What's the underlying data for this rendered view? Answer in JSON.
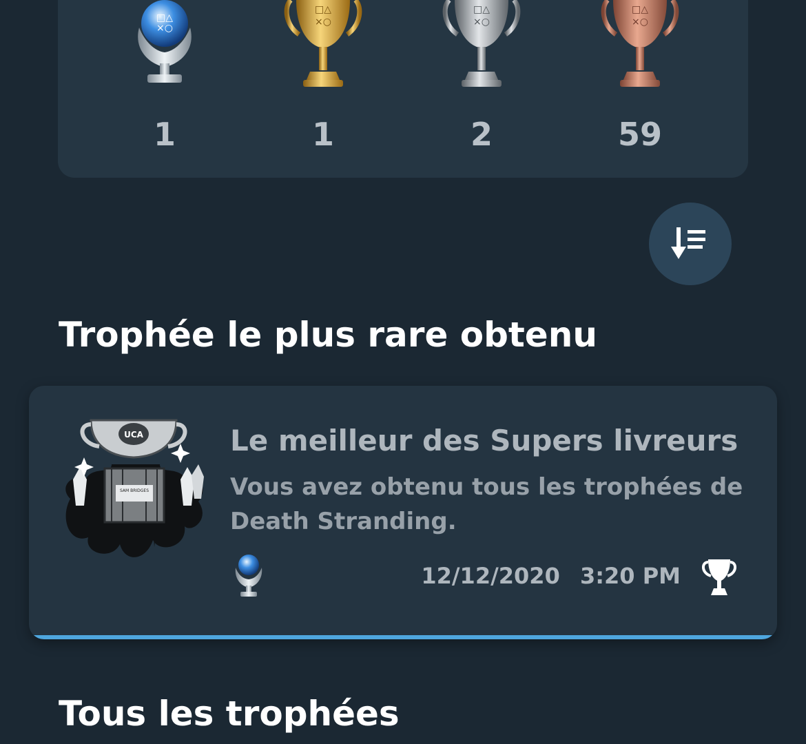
{
  "summary": {
    "trophies": [
      {
        "grade": "platinum",
        "icon": "platinum-trophy-icon",
        "count": "1"
      },
      {
        "grade": "gold",
        "icon": "gold-trophy-icon",
        "count": "1"
      },
      {
        "grade": "silver",
        "icon": "silver-trophy-icon",
        "count": "2"
      },
      {
        "grade": "bronze",
        "icon": "bronze-trophy-icon",
        "count": "59"
      }
    ]
  },
  "sort_button": {
    "icon": "sort-descending-icon"
  },
  "rarest": {
    "heading": "Trophée le plus rare obtenu",
    "name": "Le meilleur des Supers livreurs",
    "description": "Vous avez obtenu tous les trophées de Death Stranding.",
    "art_icon": "uca-trophy-art",
    "grade_icon": "platinum-trophy-icon",
    "date": "12/12/2020",
    "time": "3:20 PM",
    "earned_icon": "trophy-earned-icon",
    "accent_color": "#4ea6de"
  },
  "all_trophies": {
    "heading": "Tous les trophées"
  },
  "colors": {
    "background": "#1b2833",
    "card": "#253643",
    "sort_button": "#2c4559"
  }
}
